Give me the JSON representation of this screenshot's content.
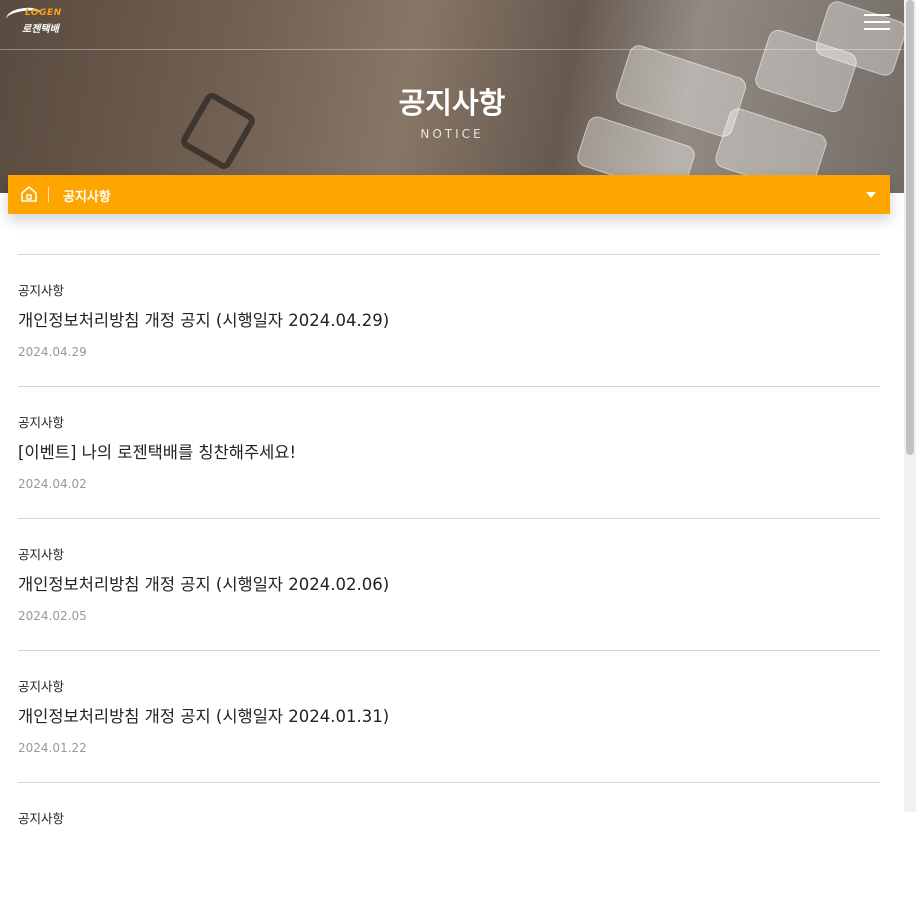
{
  "brand": {
    "logo_en": "LOGEN",
    "logo_kr": "로젠택배",
    "accent_color": "#ffa500",
    "logo_accent": "#f4a21b"
  },
  "hero": {
    "title": "공지사항",
    "subtitle": "NOTICE"
  },
  "header": {
    "menu_icon": "hamburger-menu-icon"
  },
  "breadcrumb": {
    "home_icon": "home-icon",
    "current": "공지사항",
    "dropdown_icon": "caret-down-icon"
  },
  "notices": [
    {
      "category": "공지사항",
      "title": "개인정보처리방침 개정 공지 (시행일자 2024.04.29)",
      "date": "2024.04.29"
    },
    {
      "category": "공지사항",
      "title": "[이벤트] 나의 로젠택배를 칭찬해주세요!",
      "date": "2024.04.02"
    },
    {
      "category": "공지사항",
      "title": "개인정보처리방침 개정 공지 (시행일자 2024.02.06)",
      "date": "2024.02.05"
    },
    {
      "category": "공지사항",
      "title": "개인정보처리방침 개정 공지 (시행일자 2024.01.31)",
      "date": "2024.01.22"
    },
    {
      "category": "공지사항",
      "title": "",
      "date": ""
    }
  ]
}
